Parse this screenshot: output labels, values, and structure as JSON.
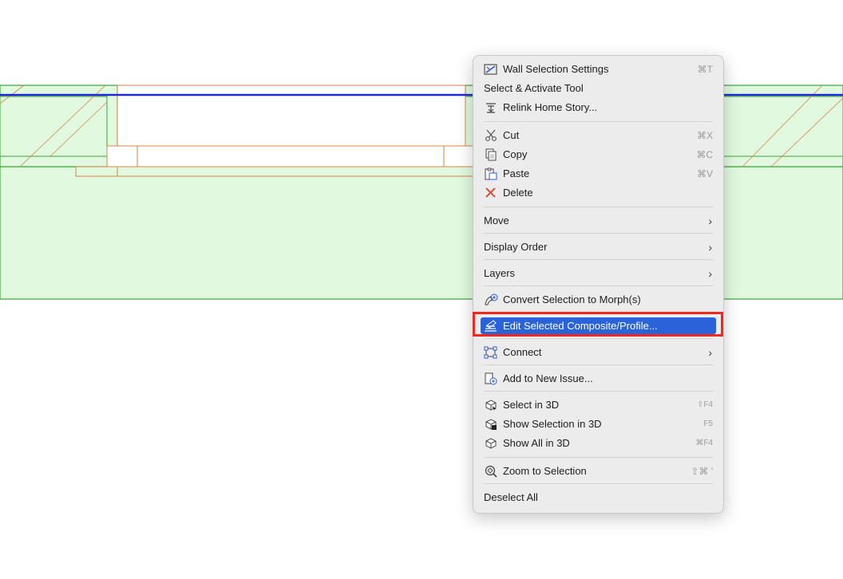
{
  "context_menu": {
    "groups": [
      [
        {
          "label": "Wall Selection Settings",
          "shortcut": "⌘T",
          "icon": "wall-settings-icon"
        },
        {
          "label": "Select & Activate Tool",
          "shortcut": "",
          "icon": ""
        },
        {
          "label": "Relink Home Story...",
          "shortcut": "",
          "icon": "relink-story-icon"
        }
      ],
      [
        {
          "label": "Cut",
          "shortcut": "⌘X",
          "icon": "scissors-icon"
        },
        {
          "label": "Copy",
          "shortcut": "⌘C",
          "icon": "copy-icon"
        },
        {
          "label": "Paste",
          "shortcut": "⌘V",
          "icon": "paste-icon"
        },
        {
          "label": "Delete",
          "shortcut": "",
          "icon": "delete-icon"
        }
      ],
      [
        {
          "label": "Move",
          "submenu": true
        }
      ],
      [
        {
          "label": "Display Order",
          "submenu": true
        }
      ],
      [
        {
          "label": "Layers",
          "submenu": true
        }
      ],
      [
        {
          "label": "Convert Selection to Morph(s)",
          "icon": "morph-icon"
        }
      ],
      [
        {
          "label": "Edit Selected Composite/Profile...",
          "icon": "composite-profile-icon",
          "highlighted": true
        }
      ],
      [
        {
          "label": "Connect",
          "icon": "connect-icon",
          "submenu": true
        }
      ],
      [
        {
          "label": "Add to New Issue...",
          "icon": "issue-icon"
        }
      ],
      [
        {
          "label": "Select in 3D",
          "shortcut": "⇧F4",
          "icon": "select-3d-icon"
        },
        {
          "label": "Show Selection in 3D",
          "shortcut": "F5",
          "icon": "show-selection-3d-icon"
        },
        {
          "label": "Show All in 3D",
          "shortcut": "⌘F4",
          "icon": "show-all-3d-icon"
        }
      ],
      [
        {
          "label": "Zoom to Selection",
          "shortcut": "⇧⌘ '",
          "icon": "zoom-selection-icon"
        }
      ],
      [
        {
          "label": "Deselect All"
        }
      ]
    ]
  },
  "colors": {
    "wall_fill": "#e1fadf",
    "wall_outline": "#3aa43a",
    "opening_outline": "#d9834a",
    "reference_line": "#1d2bd6",
    "highlight": "#2962d9",
    "annotation": "#ee2a1f"
  }
}
